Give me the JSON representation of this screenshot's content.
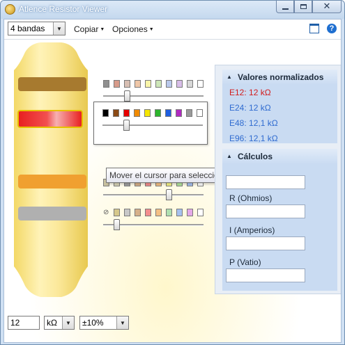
{
  "window": {
    "title": "Atlence Resistor Viewer",
    "minimize_label": "minimize",
    "maximize_label": "maximize",
    "close_label": "close"
  },
  "toolbar": {
    "bands_selected": "4 bandas",
    "copy_label": "Copiar",
    "options_label": "Opciones",
    "window_icon": "window-icon",
    "help_icon": "help-icon",
    "help_glyph": "?"
  },
  "resistor": {
    "band_colors": [
      "#a77a2f",
      "#e82020",
      "#f0a030",
      "#b0b0b0"
    ],
    "selected_band": 2,
    "body_color": "#fbe89a"
  },
  "pickers": [
    {
      "swatches": [
        "#909090",
        "#d79b8a",
        "#d8bfb3",
        "#efc7a8",
        "#f9f5a8",
        "#cde6b8",
        "#b9c8eb",
        "#d8bde8",
        "#d8d8d8",
        "#ffffff"
      ],
      "slider_value": 2,
      "boxed": false
    },
    {
      "swatches": [
        "#000000",
        "#8b4a16",
        "#e80000",
        "#f08a00",
        "#f5e600",
        "#2db52d",
        "#1f5fe0",
        "#b02ac0",
        "#9a9a9a",
        "#ffffff"
      ],
      "slider_value": 2,
      "boxed": true
    },
    {
      "swatches": [
        "#c9c1a0",
        "#d8d4b8",
        "#9f9f9f",
        "#d7b18a",
        "#f38d8d",
        "#f4c084",
        "#f6f386",
        "#b5e69e",
        "#a7c1ef",
        "#ffffff"
      ],
      "slider_value": 6,
      "boxed": false
    },
    {
      "swatches": [
        "none",
        "#d6c88b",
        "#c8c8c8",
        "#d7b18a",
        "#f38d8d",
        "#f4c084",
        "#b0e0b0",
        "#a7c1ef",
        "#e5a9e8",
        "#ffffff"
      ],
      "slider_value": 1,
      "boxed": false
    }
  ],
  "tooltip": "Mover el cursor para seleccionar el color de la banda.",
  "side": {
    "normalized_title": "Valores normalizados",
    "normalized": [
      "E12: 12 kΩ",
      "E24: 12 kΩ",
      "E48: 12,1 kΩ",
      "E96: 12,1 kΩ"
    ],
    "active_index": 0,
    "calc_title": "Cálculos",
    "calc_fields": [
      "",
      "R (Ohmios)",
      "I (Amperios)",
      "P (Vatio)"
    ]
  },
  "bottom": {
    "value": "12",
    "unit": "kΩ",
    "tolerance": "±10%"
  }
}
